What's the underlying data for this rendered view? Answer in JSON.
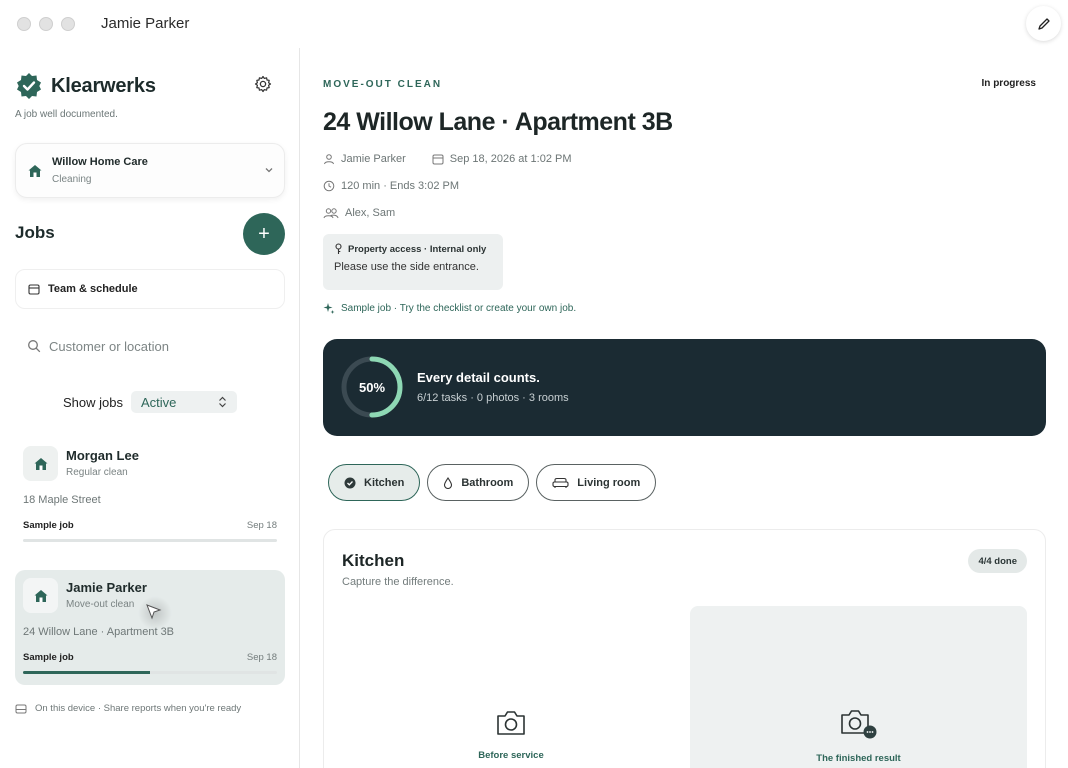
{
  "window": {
    "title": "Jamie Parker"
  },
  "brand": {
    "name": "Klearwerks",
    "tagline": "A job well documented.",
    "color": "#2e6659"
  },
  "org": {
    "name": "Willow Home Care",
    "sub": "Cleaning"
  },
  "jobs_section": {
    "title": "Jobs",
    "add_label": "+",
    "team_label": "Team & schedule",
    "search_placeholder": "Customer or location",
    "show_label": "Show jobs",
    "show_value": "Active"
  },
  "jobs": [
    {
      "name": "Morgan Lee",
      "type": "Regular clean",
      "address": "18 Maple Street",
      "tag": "Sample job",
      "date": "Sep 18",
      "progress": 0,
      "active": false
    },
    {
      "name": "Jamie Parker",
      "type": "Move-out clean",
      "address": "24 Willow Lane · Apartment 3B",
      "tag": "Sample job",
      "date": "Sep 18",
      "progress": 0.5,
      "active": true
    }
  ],
  "footer_note": "On this device · Share reports when you're ready",
  "job": {
    "eyebrow": "MOVE-OUT CLEAN",
    "status": "In progress",
    "title": "24 Willow Lane · Apartment 3B",
    "customer": "Jamie Parker",
    "datetime": "Sep 18, 2026 at 1:02 PM",
    "duration": "120 min · Ends 3:02 PM",
    "team": "Alex, Sam",
    "access_title": "Property access · Internal only",
    "access_body": "Please use the side entrance.",
    "sample_note": "Sample job · Try the checklist or create your own job."
  },
  "hero": {
    "percent_label": "50%",
    "percent": 0.5,
    "title": "Every detail counts.",
    "sub": "6/12 tasks · 0 photos · 3 rooms",
    "bg": "#1b2b33",
    "ring_color": "#8ed8b4"
  },
  "tabs": [
    {
      "label": "Kitchen",
      "icon": "check-circle-icon",
      "active": true
    },
    {
      "label": "Bathroom",
      "icon": "droplet-icon",
      "active": false
    },
    {
      "label": "Living room",
      "icon": "sofa-icon",
      "active": false
    }
  ],
  "room": {
    "title": "Kitchen",
    "sub": "Capture the difference.",
    "badge": "4/4 done",
    "before_label": "Before service",
    "after_label": "The finished result"
  }
}
